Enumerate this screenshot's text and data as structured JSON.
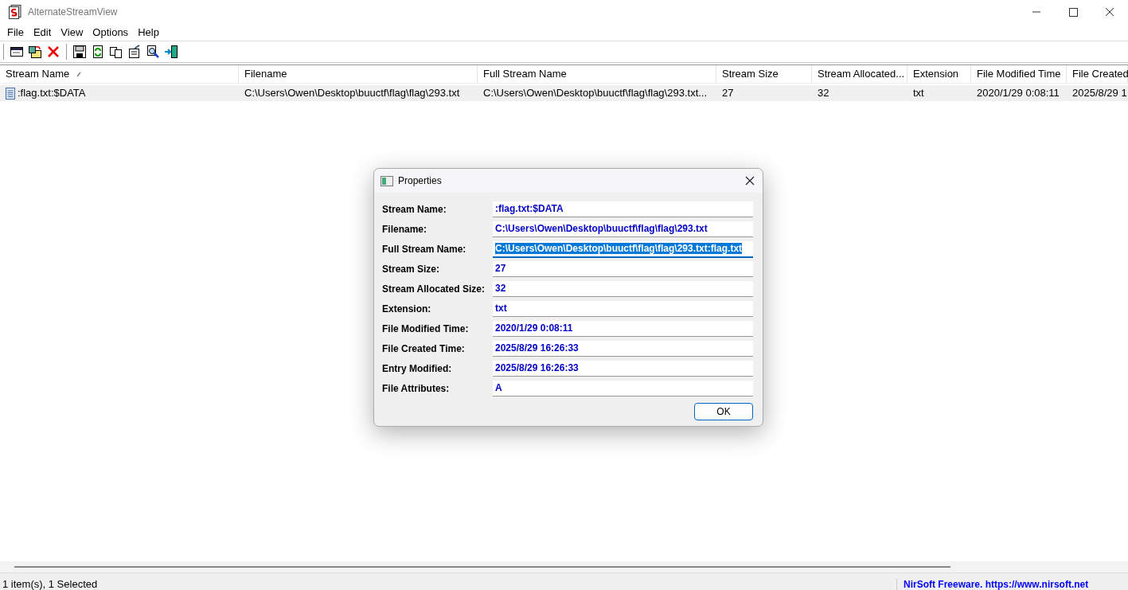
{
  "window": {
    "title": "AlternateStreamView"
  },
  "menu": [
    "File",
    "Edit",
    "View",
    "Options",
    "Help"
  ],
  "table": {
    "columns": [
      {
        "label": "Stream Name",
        "sorted": true
      },
      {
        "label": "Filename",
        "sorted": false
      },
      {
        "label": "Full Stream Name",
        "sorted": false
      },
      {
        "label": "Stream Size",
        "sorted": false
      },
      {
        "label": "Stream Allocated...",
        "sorted": false
      },
      {
        "label": "Extension",
        "sorted": false
      },
      {
        "label": "File Modified Time",
        "sorted": false
      },
      {
        "label": "File Created",
        "sorted": false
      }
    ],
    "rows": [
      {
        "selected": true,
        "cells": [
          ":flag.txt:$DATA",
          "C:\\Users\\Owen\\Desktop\\buuctf\\flag\\flag\\293.txt",
          "C:\\Users\\Owen\\Desktop\\buuctf\\flag\\flag\\293.txt...",
          "27",
          "32",
          "txt",
          "2020/1/29 0:08:11",
          "2025/8/29 1"
        ]
      }
    ]
  },
  "dialog": {
    "title": "Properties",
    "fields": [
      {
        "label": "Stream Name:",
        "value": ":flag.txt:$DATA",
        "selected": false
      },
      {
        "label": "Filename:",
        "value": "C:\\Users\\Owen\\Desktop\\buuctf\\flag\\flag\\293.txt",
        "selected": false
      },
      {
        "label": "Full Stream Name:",
        "value": "C:\\Users\\Owen\\Desktop\\buuctf\\flag\\flag\\293.txt:flag.txt",
        "selected": true
      },
      {
        "label": "Stream Size:",
        "value": "27",
        "selected": false
      },
      {
        "label": "Stream Allocated Size:",
        "value": "32",
        "selected": false
      },
      {
        "label": "Extension:",
        "value": "txt",
        "selected": false
      },
      {
        "label": "File Modified Time:",
        "value": "2020/1/29 0:08:11",
        "selected": false
      },
      {
        "label": "File Created Time:",
        "value": "2025/8/29 16:26:33",
        "selected": false
      },
      {
        "label": "Entry Modified:",
        "value": "2025/8/29 16:26:33",
        "selected": false
      },
      {
        "label": "File Attributes:",
        "value": "A",
        "selected": false
      }
    ],
    "ok_button": "OK"
  },
  "status_bar": {
    "count": "1 item(s), 1 Selected",
    "link": "NirSoft Freeware. https://www.nirsoft.net"
  }
}
